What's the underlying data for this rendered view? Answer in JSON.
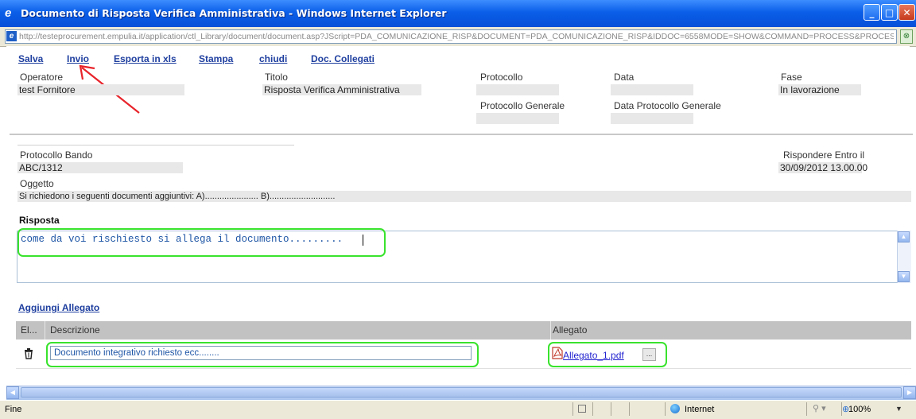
{
  "window": {
    "title": "Documento di Risposta Verifica Amministrativa - Windows Internet Explorer",
    "url": "http://testeprocurement.empulia.it/application/ctl_Library/document/document.asp?JScript=PDA_COMUNICAZIONE_RISP&DOCUMENT=PDA_COMUNICAZIONE_RISP&IDDOC=6558MODE=SHOW&COMMAND=PROCESS&PROCES"
  },
  "toolbar": {
    "salva": "Salva",
    "invio": "Invio",
    "esporta": "Esporta in xls",
    "stampa": "Stampa",
    "chiudi": "chiudi",
    "doc_collegati": "Doc. Collegati"
  },
  "header": {
    "operatore_label": "Operatore",
    "operatore_value": "test Fornitore",
    "titolo_label": "Titolo",
    "titolo_value": "Risposta Verifica Amministrativa",
    "protocollo_label": "Protocollo",
    "protocollo_value": "",
    "data_label": "Data",
    "data_value": "",
    "fase_label": "Fase",
    "fase_value": "In lavorazione",
    "protocollo_generale_label": "Protocollo Generale",
    "protocollo_generale_value": "",
    "data_protocollo_generale_label": "Data Protocollo Generale",
    "data_protocollo_generale_value": ""
  },
  "bando": {
    "protocollo_bando_label": "Protocollo Bando",
    "protocollo_bando_value": "ABC/1312",
    "rispondere_label": "Rispondere Entro il",
    "rispondere_value": "30/09/2012 13.00.00",
    "oggetto_label": "Oggetto",
    "oggetto_value": "Si richiedono i seguenti documenti aggiuntivi: A)...................... B)..........................."
  },
  "risposta": {
    "label": "Risposta",
    "text": "come da voi rischiesto si allega il documento........."
  },
  "allegati": {
    "add_link": "Aggiungi Allegato",
    "columns": [
      "El...",
      "Descrizione",
      "Allegato"
    ],
    "rows": [
      {
        "descrizione": "Documento integrativo richiesto ecc........",
        "allegato": "Allegato_1.pdf",
        "more": "..."
      }
    ]
  },
  "status": {
    "text": "Fine",
    "zone": "Internet",
    "zoom": "100%"
  },
  "colors": {
    "titlebar": "#0a5ee8",
    "link": "#1f3f9f",
    "highlight": "#39e32d",
    "annotation_arrow": "#e8232a"
  },
  "icons": [
    "ie-icon",
    "minimize-icon",
    "maximize-icon",
    "close-icon",
    "trash-icon",
    "pdf-icon",
    "globe-icon"
  ]
}
